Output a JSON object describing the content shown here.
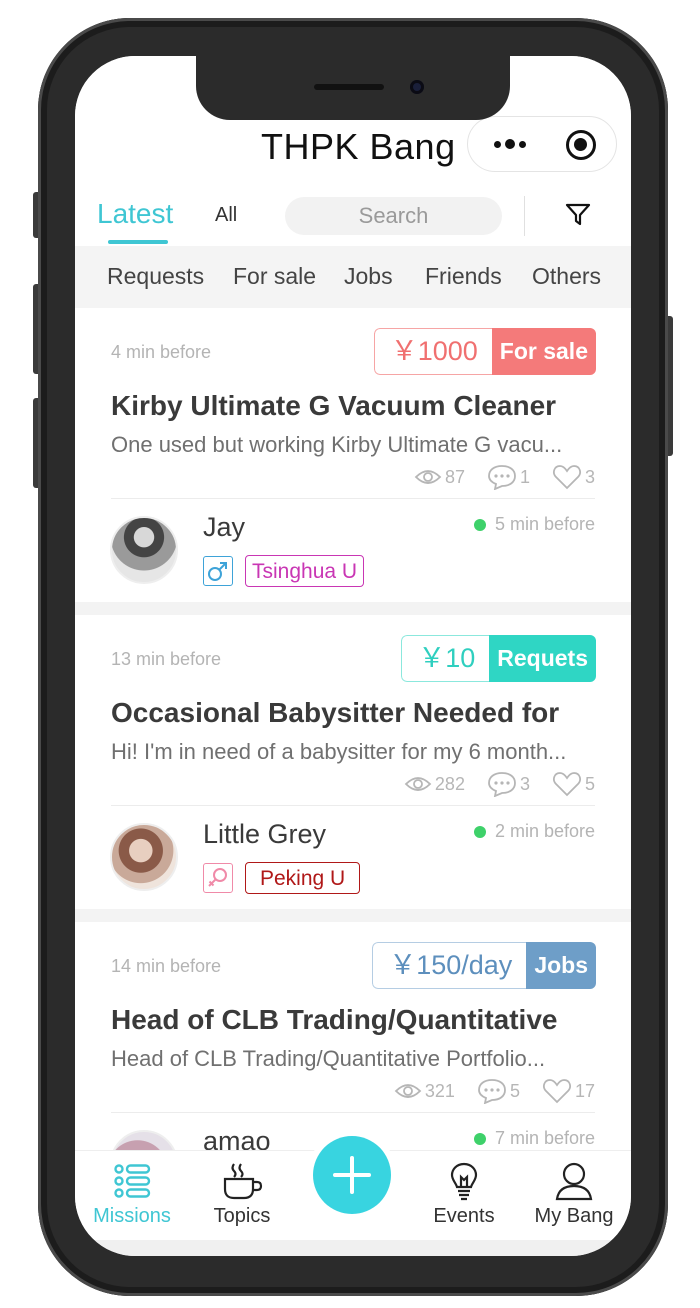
{
  "app": {
    "title": "THPK Bang"
  },
  "tabs": {
    "latest": "Latest",
    "all": "All"
  },
  "search": {
    "placeholder": "Search"
  },
  "categories": [
    "Requests",
    "For sale",
    "Jobs",
    "Friends",
    "Others"
  ],
  "posts": [
    {
      "time": "4 min before",
      "price": "￥1000",
      "category": "For sale",
      "title": "Kirby Ultimate G Vacuum Cleaner",
      "description": "One used but working Kirby Ultimate G vacu...",
      "views": "87",
      "comments": "1",
      "likes": "3",
      "user": "Jay",
      "school": "Tsinghua U",
      "gender": "male",
      "online": "5 min before",
      "accent": "#f47a7a",
      "tag_text_color": "#f07070",
      "school_color": "#c936b4"
    },
    {
      "time": "13 min before",
      "price": "￥10",
      "category": "Requets",
      "title": "Occasional Babysitter Needed for",
      "description": "Hi! I'm in need of a babysitter for my 6 month...",
      "views": "282",
      "comments": "3",
      "likes": "5",
      "user": "Little Grey",
      "school": "Peking U",
      "gender": "female",
      "online": "2 min before",
      "accent": "#2fd6c4",
      "tag_text_color": "#2fcfbf",
      "school_color": "#b01818"
    },
    {
      "time": "14 min before",
      "price": "￥150/day",
      "category": "Jobs",
      "title": "Head of CLB Trading/Quantitative",
      "description": "Head of CLB Trading/Quantitative Portfolio...",
      "views": "321",
      "comments": "5",
      "likes": "17",
      "user": "amao",
      "school": "",
      "gender": "",
      "online": "7 min before",
      "accent": "#6e9ec8",
      "tag_text_color": "#5d8fbd",
      "school_color": "#999999"
    }
  ],
  "bottom_nav": {
    "missions": "Missions",
    "topics": "Topics",
    "events": "Events",
    "my_bang": "My Bang"
  },
  "colors": {
    "primary": "#3fc6d3",
    "fab": "#38d4e0",
    "online_dot": "#3ed16a"
  }
}
